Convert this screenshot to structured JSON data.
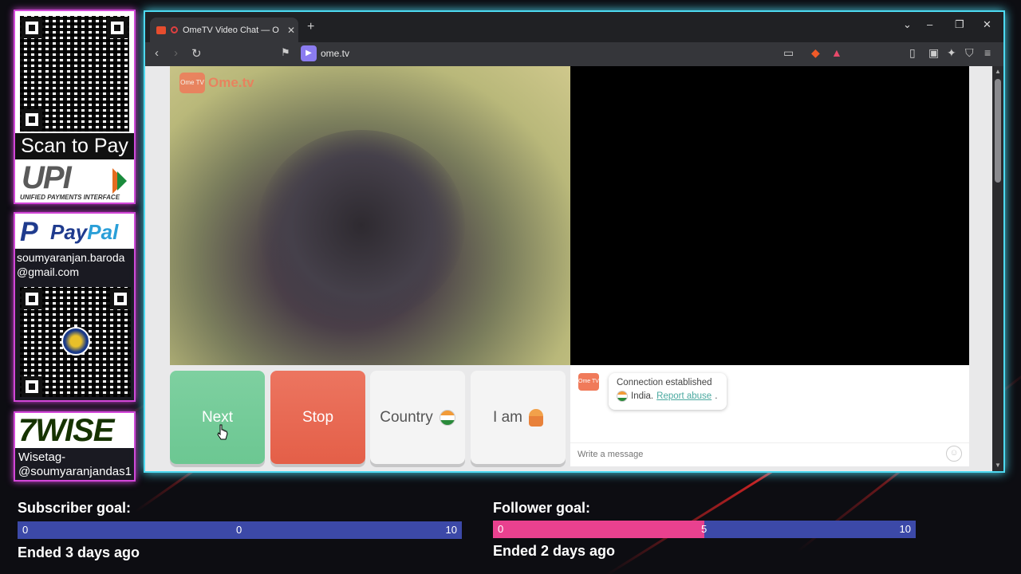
{
  "overlay": {
    "upi": {
      "scan_text": "Scan to Pay",
      "logo_text": "UPI",
      "logo_sub": "UNIFIED PAYMENTS INTERFACE"
    },
    "paypal": {
      "logo_p": "P",
      "logo_word_a": "Pay",
      "logo_word_b": "Pal",
      "email_line1": "soumyaranjan.baroda",
      "email_line2": "@gmail.com"
    },
    "wise": {
      "logo_text": "7WISE",
      "tag_line1": "Wisetag-",
      "tag_line2": "@soumyaranjandas1"
    }
  },
  "browser": {
    "tab_title": "OmeTV Video Chat — Omeg",
    "tab_close": "✕",
    "new_tab": "+",
    "url": "ome.tv",
    "window_controls": {
      "dropdown": "⌄",
      "minimize": "–",
      "restore": "❐",
      "close": "✕"
    }
  },
  "page": {
    "logo_icon_text": "Ome TV",
    "logo_name": "Ome.tv",
    "buttons": {
      "next": "Next",
      "stop": "Stop",
      "country": "Country",
      "iam": "I am"
    },
    "chat": {
      "line1": "Connection established",
      "country": "India.",
      "report": "Report abuse",
      "report_suffix": ".",
      "input_placeholder": "Write a message"
    }
  },
  "goals": {
    "subscriber": {
      "title": "Subscriber goal:",
      "start": "0",
      "current": "0",
      "target": "10",
      "progress": 0.0,
      "status": "Ended 3 days ago"
    },
    "follower": {
      "title": "Follower goal:",
      "start": "0",
      "current": "5",
      "target": "10",
      "progress": 0.5,
      "status": "Ended 2 days ago"
    }
  },
  "colors": {
    "accent_cyan": "#4dd9f0",
    "accent_pink": "#d246d8",
    "next_green": "#6cc792",
    "stop_red": "#e45f48",
    "goal_blue": "#3c49a8",
    "goal_pink": "#e9418f"
  }
}
